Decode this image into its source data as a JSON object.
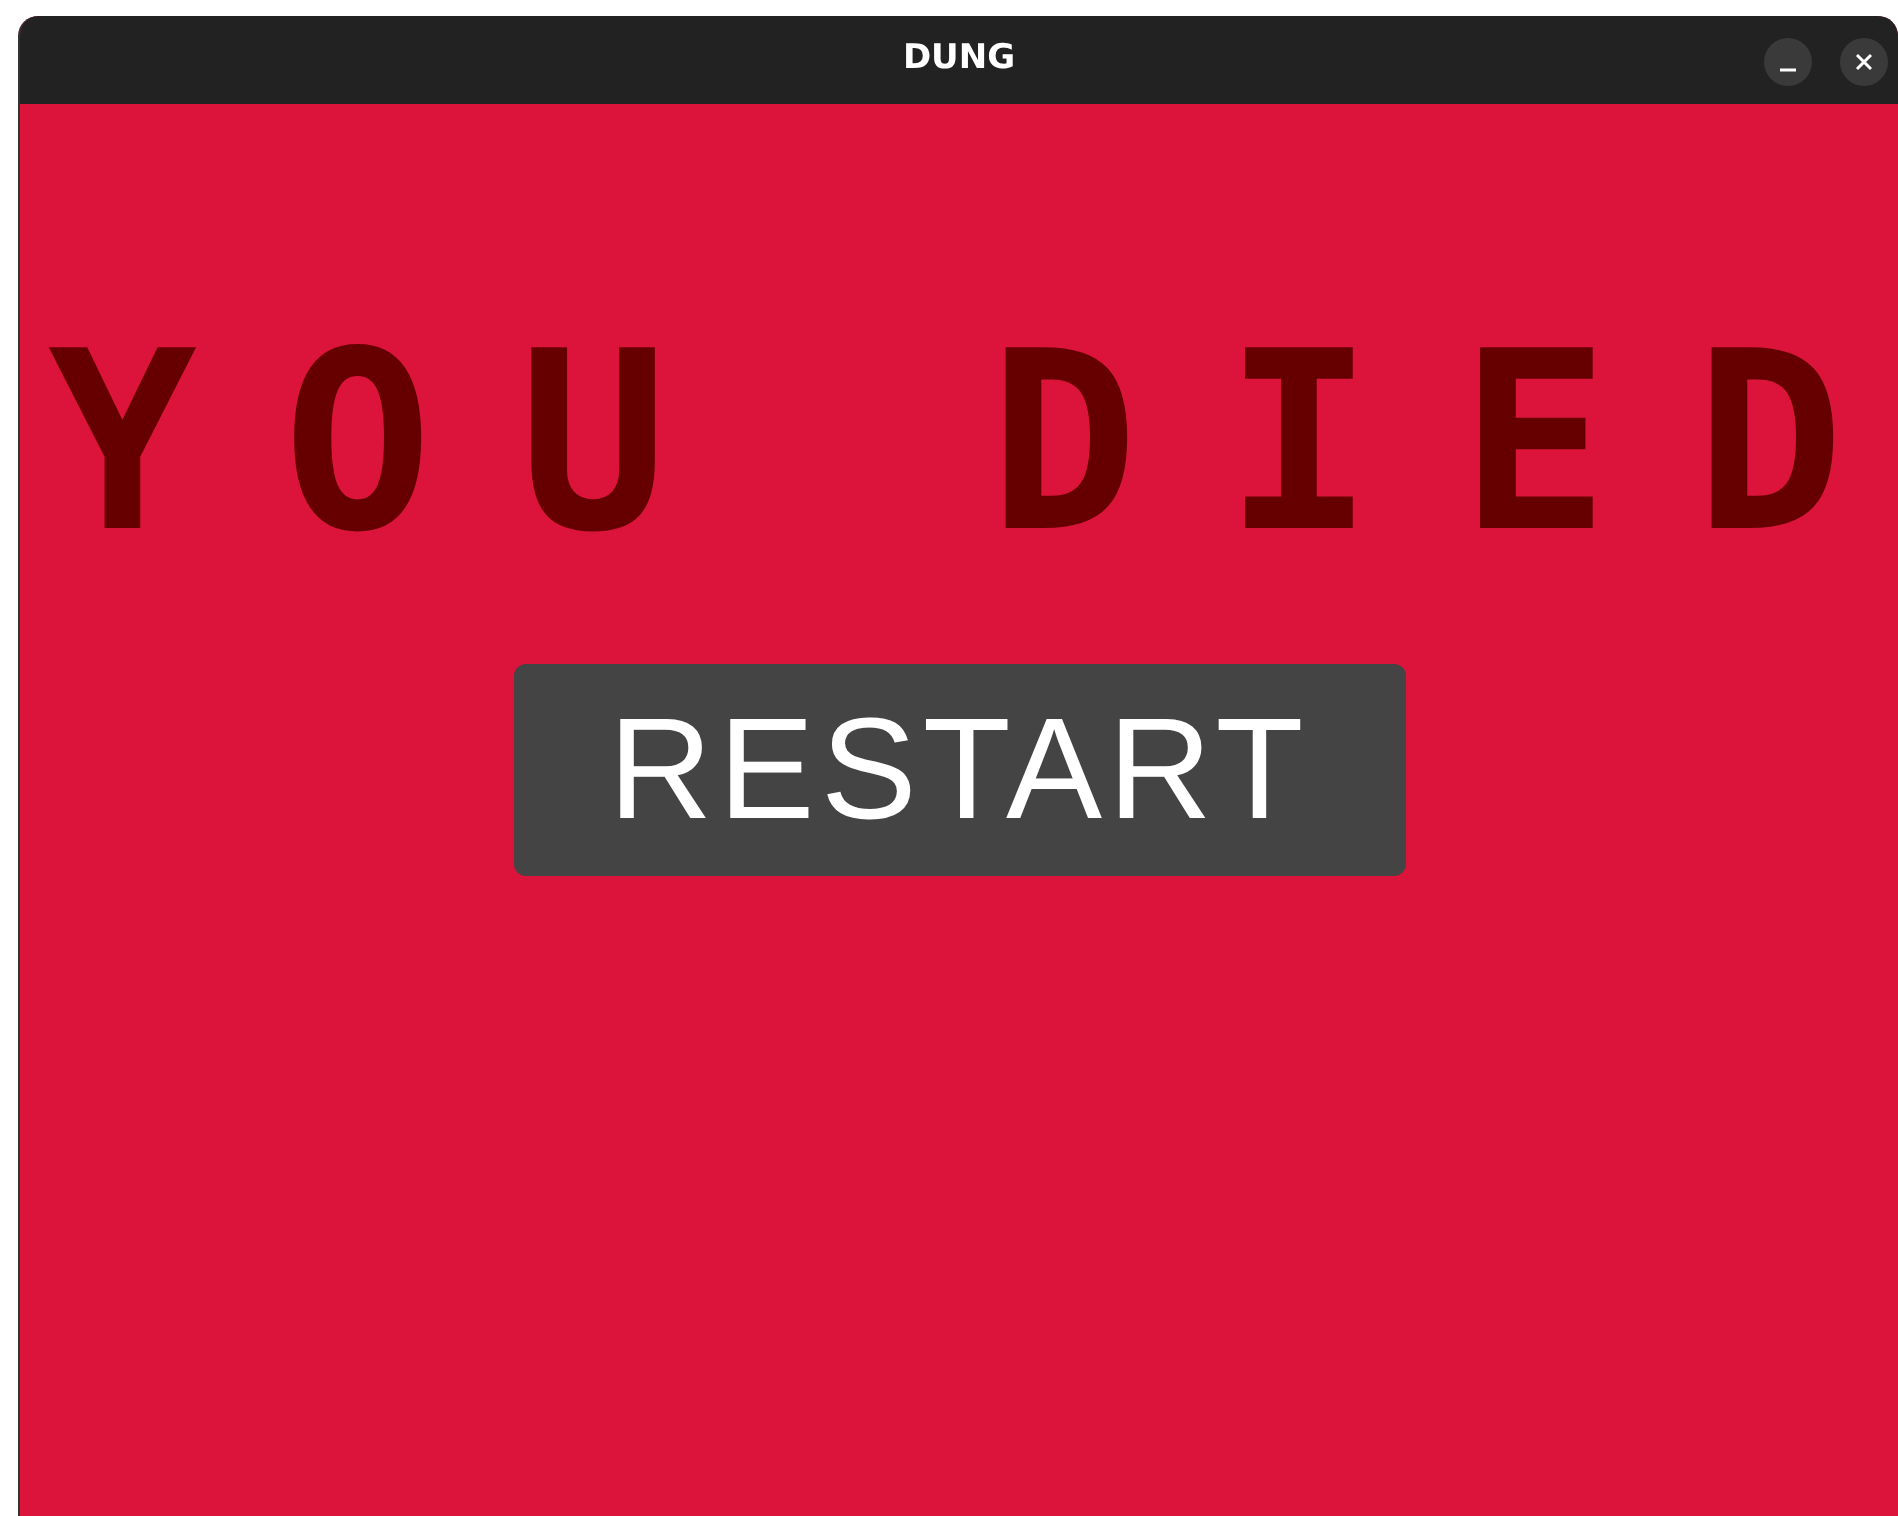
{
  "window": {
    "title": "DUNG"
  },
  "heading": "YOU DIED",
  "buttons": [
    {
      "label": "RESTART"
    }
  ]
}
